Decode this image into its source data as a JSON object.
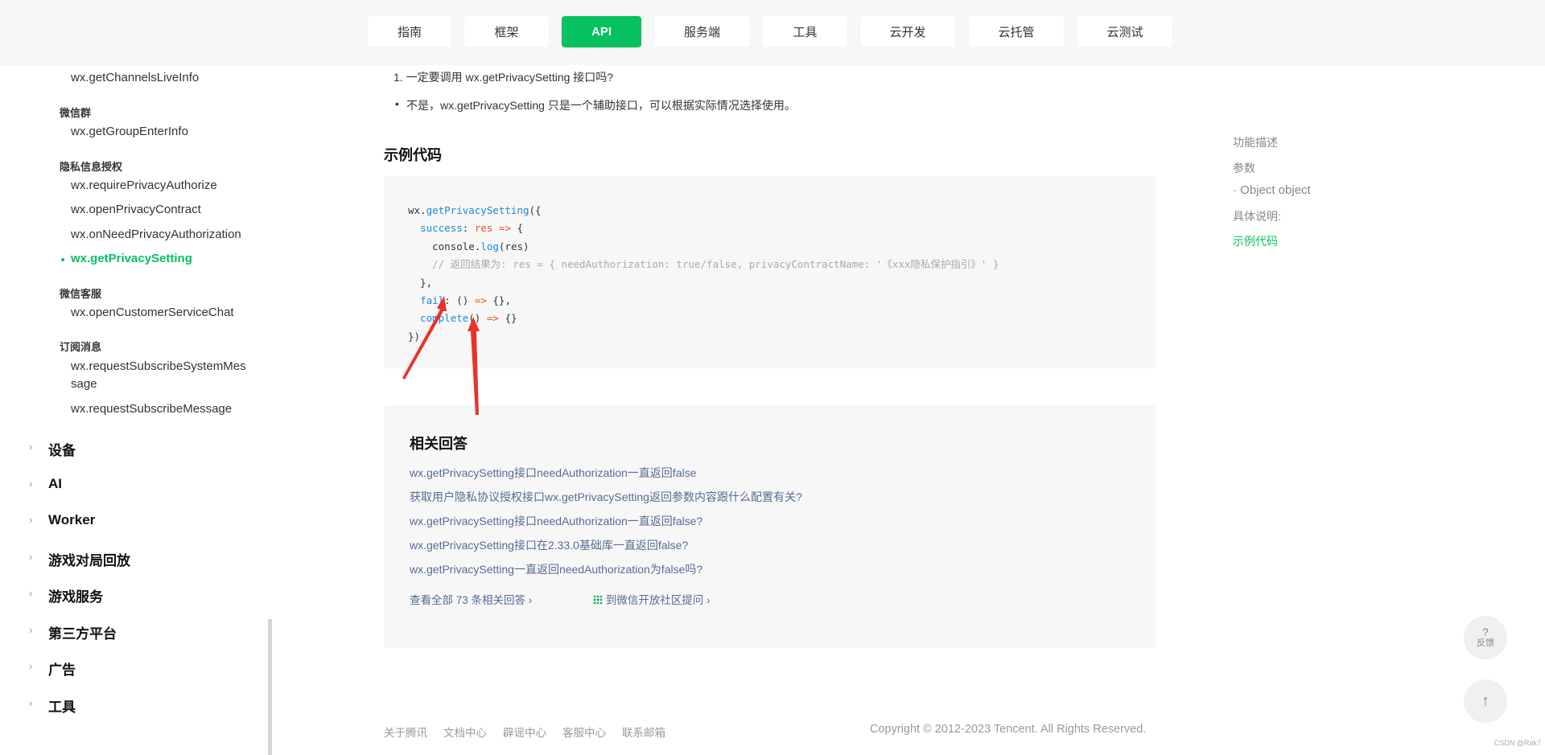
{
  "nav": {
    "tabs": [
      {
        "label": "指南"
      },
      {
        "label": "框架"
      },
      {
        "label": "API"
      },
      {
        "label": "服务端"
      },
      {
        "label": "工具"
      },
      {
        "label": "云开发"
      },
      {
        "label": "云托管"
      },
      {
        "label": "云测试"
      }
    ]
  },
  "sidebar": {
    "items": [
      {
        "kind": "sub",
        "label": "wx.getChannelsLiveInfo"
      },
      {
        "kind": "group",
        "label": "微信群"
      },
      {
        "kind": "sub",
        "label": "wx.getGroupEnterInfo"
      },
      {
        "kind": "group",
        "label": "隐私信息授权"
      },
      {
        "kind": "sub",
        "label": "wx.requirePrivacyAuthorize"
      },
      {
        "kind": "sub",
        "label": "wx.openPrivacyContract"
      },
      {
        "kind": "sub",
        "label": "wx.onNeedPrivacyAuthorization"
      },
      {
        "kind": "active",
        "label": "wx.getPrivacySetting"
      },
      {
        "kind": "group",
        "label": "微信客服"
      },
      {
        "kind": "sub",
        "label": "wx.openCustomerServiceChat"
      },
      {
        "kind": "group",
        "label": "订阅消息"
      },
      {
        "kind": "sub",
        "label": "wx.requestSubscribeSystemMes"
      },
      {
        "kind": "sub",
        "label": "sage"
      },
      {
        "kind": "sub",
        "label": "wx.requestSubscribeMessage"
      }
    ],
    "top": [
      {
        "label": "设备"
      },
      {
        "label": "AI"
      },
      {
        "label": "Worker"
      },
      {
        "label": "游戏对局回放"
      },
      {
        "label": "游戏服务"
      },
      {
        "label": "第三方平台"
      },
      {
        "label": "广告"
      },
      {
        "label": "工具"
      }
    ]
  },
  "main": {
    "faq_q": "1. 一定要调用 wx.getPrivacySetting 接口吗?",
    "faq_bullet": "•",
    "faq_a": "不是，wx.getPrivacySetting 只是一个辅助接口，可以根据实际情况选择使用。",
    "example_heading": "示例代码",
    "code": {
      "l1a": "wx.",
      "l1b": "getPrivacySetting",
      "l1c": "({",
      "l2a": "  ",
      "l2b": "success",
      "l2c": ": ",
      "l2d": "res",
      "l2e": " => ",
      "l2f": "{",
      "l3a": "    console.",
      "l3b": "log",
      "l3c": "(res)",
      "l4": "    // 返回结果为: res = { needAuthorization: true/false, privacyContractName: '《xxx隐私保护指引》' }",
      "l5": "  },",
      "l6a": "  ",
      "l6b": "fail",
      "l6c": ": () ",
      "l6d": "=>",
      "l6e": " {},",
      "l7a": "  ",
      "l7b": "complete",
      "l7c": "() ",
      "l7d": "=>",
      "l7e": " {}",
      "l8": "})"
    },
    "related_heading": "相关回答",
    "related": [
      "wx.getPrivacySetting接口needAuthorization一直返回false",
      "获取用户隐私协议授权接口wx.getPrivacySetting返回参数内容跟什么配置有关?",
      "wx.getPrivacySetting接口needAuthorization一直返回false?",
      "wx.getPrivacySetting接口在2.33.0基础库一直返回false?",
      "wx.getPrivacySetting一直返回needAuthorization为false吗?"
    ],
    "view_all": "查看全部 73 条相关回答",
    "ask_community": "到微信开放社区提问",
    "chevron": "›"
  },
  "footer": {
    "links": [
      "关于腾讯",
      "文档中心",
      "辟谣中心",
      "客服中心",
      "联系邮箱"
    ],
    "copyright": "Copyright © 2012-2023 Tencent. All Rights Reserved."
  },
  "toc": [
    {
      "label": "功能描述"
    },
    {
      "label": "参数"
    },
    {
      "label": "· Object object"
    },
    {
      "label": "具体说明:"
    },
    {
      "label": "示例代码"
    }
  ],
  "fab": {
    "feedback_q": "?",
    "feedback_label": "反馈",
    "top_arrow": "↑"
  },
  "corner": "CSDN @Rak7",
  "colors": {
    "accent": "#07c160",
    "link": "#576b95",
    "annotation": "#e8332a"
  }
}
